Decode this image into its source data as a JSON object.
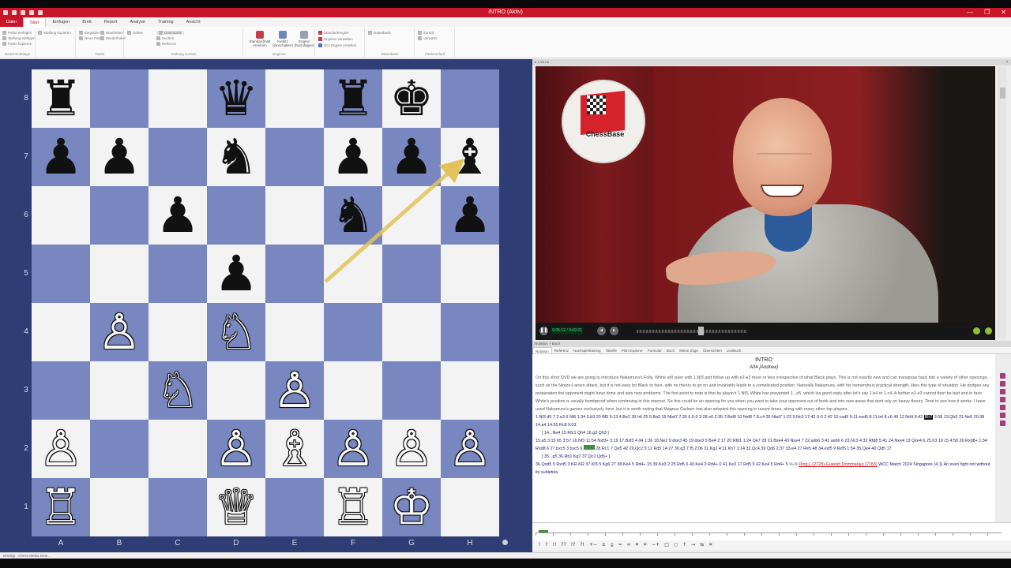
{
  "window": {
    "title": "INTRO (Aktiv)",
    "controls": [
      "—",
      "❐",
      "✕"
    ]
  },
  "ribbon_tabs": [
    "Datei",
    "Start",
    "Einfügen",
    "Brett",
    "Report",
    "Analyse",
    "Training",
    "Ansicht"
  ],
  "ribbon": {
    "groups": [
      {
        "label": "Zwischenablage",
        "items": [
          "Partie einfügen",
          "Stellung einfügen",
          "Partie kopieren",
          "Stellung kopieren"
        ]
      },
      {
        "label": "Partie",
        "items": [
          "Eingeben",
          "Neue Partie",
          "Bearbeiten",
          "Wiederholen"
        ]
      },
      {
        "label": "Stellung suchen",
        "items": [
          "Online",
          "Datenbank",
          "Suchen",
          "Referenz"
        ]
      },
      {
        "label": "",
        "items": [
          "Standardmatt",
          "Referenz"
        ]
      },
      {
        "label": "Engines",
        "items": [
          "Standardengine",
          "Kiebitz",
          "Engines verwalten",
          "UCI Engine erstellen"
        ]
      },
      {
        "label": "Datenbank",
        "items": [
          "Datenbank"
        ]
      },
      {
        "label": "Partieverlauf",
        "items": [
          "Zurück",
          "Vorwärts"
        ]
      }
    ],
    "big_buttons": [
      "Standardmatt ersetzen",
      "Kiebitz (einschalten)",
      "Engine (hinzufügen)"
    ]
  },
  "board": {
    "ranks": [
      "8",
      "7",
      "6",
      "5",
      "4",
      "3",
      "2",
      "1"
    ],
    "files": [
      "A",
      "B",
      "C",
      "D",
      "E",
      "F",
      "G",
      "H"
    ],
    "pieces": [
      {
        "sq": "a8",
        "glyph": "♜",
        "color": "black"
      },
      {
        "sq": "d8",
        "glyph": "♛",
        "color": "black"
      },
      {
        "sq": "f8",
        "glyph": "♜",
        "color": "black"
      },
      {
        "sq": "g8",
        "glyph": "♚",
        "color": "black"
      },
      {
        "sq": "a7",
        "glyph": "♟",
        "color": "black"
      },
      {
        "sq": "b7",
        "glyph": "♟",
        "color": "black"
      },
      {
        "sq": "d7",
        "glyph": "♞",
        "color": "black"
      },
      {
        "sq": "f7",
        "glyph": "♟",
        "color": "black"
      },
      {
        "sq": "g7",
        "glyph": "♟",
        "color": "black"
      },
      {
        "sq": "h7",
        "glyph": "♝",
        "color": "black"
      },
      {
        "sq": "c6",
        "glyph": "♟",
        "color": "black"
      },
      {
        "sq": "f6",
        "glyph": "♞",
        "color": "black"
      },
      {
        "sq": "h6",
        "glyph": "♟",
        "color": "black"
      },
      {
        "sq": "d5",
        "glyph": "♟",
        "color": "black"
      },
      {
        "sq": "b4",
        "glyph": "♙",
        "color": "white"
      },
      {
        "sq": "d4",
        "glyph": "♘",
        "color": "white"
      },
      {
        "sq": "c3",
        "glyph": "♘",
        "color": "white"
      },
      {
        "sq": "e3",
        "glyph": "♙",
        "color": "white"
      },
      {
        "sq": "a2",
        "glyph": "♙",
        "color": "white"
      },
      {
        "sq": "d2",
        "glyph": "♙",
        "color": "white"
      },
      {
        "sq": "e2",
        "glyph": "♗",
        "color": "white"
      },
      {
        "sq": "f2",
        "glyph": "♙",
        "color": "white"
      },
      {
        "sq": "g2",
        "glyph": "♙",
        "color": "white"
      },
      {
        "sq": "h2",
        "glyph": "♙",
        "color": "white"
      },
      {
        "sq": "a1",
        "glyph": "♖",
        "color": "white"
      },
      {
        "sq": "d1",
        "glyph": "♕",
        "color": "white"
      },
      {
        "sq": "f1",
        "glyph": "♖",
        "color": "white"
      },
      {
        "sq": "g1",
        "glyph": "♔",
        "color": "white"
      }
    ],
    "arrow": {
      "from": "f5",
      "to": "h7",
      "color": "#e3c25a"
    },
    "colors": {
      "light": "#f3f3f3",
      "dark": "#7887bf",
      "frame": "#2e3d73"
    }
  },
  "video": {
    "header": "▸ 1 v3 en",
    "logo_text": "ChessBase",
    "time": "0:05:12 / 0:09:21"
  },
  "notation_panel": {
    "header": "Notation + Buch",
    "tabs": [
      "Notation",
      "Referenz",
      "Nachspieltraining",
      "Tabelle",
      "Plan Explorer",
      "Formular",
      "Buch",
      "Meine Züge",
      "Übersichten",
      "LiveBuch"
    ],
    "active_tab": "Notation",
    "title": "INTRO",
    "eco": "A04",
    "annotator": "[Andrew]",
    "intro_text": "On this short DVD we are going to introduce Nakamura's Folly. White will open with 1.Nf3 and follow up with e2-e3 more or less irrespective of what Black plays. This is not exactly new and can transpose back into a variety of other openings, such as the Nimzo-Larsen attack, but it is not easy for Black to face, with no theory to go on and invariably leads to a complicated position. Naturally Nakamura, with his tremendous practical strength, likes this type of situation. He dodges any preparation the opponent might have done and sets new problems. The first point to note is that by playin's 1.Nf3, White has prevented 1...e5, which isa good reply after let's say 1.b4 or 1.c4. A further e2-e3 cannot then be bad and in face White's position is usually bombproof when continuing in this manner. So this could be an opening for you when you want to take your opponent out of book and into new areas that dont rely on heavy theory. Time to see how it works. I have used Nakamura's games exclusively here, but it is worth noting that Magnus Carlsen has also adopted this opening in recent times, along with many other top players.",
    "line1_moves": "1.Nf3 d5 7 2.e3 6 Nf6 1:34 3.b3 20 Bf5 5:13 4.Be2 39 h6 25 5.Ba3 15 Nbd7 7:26 6.0-0 3:28 e6 2:35 7.Bxf8 10 Nxf8 7 8.c4 35 Nbd7 1:23 9.Nc3 17:42 0-0 2:42 10.cxd5 5:11 exd5 8 11.b4 8 c6 49 12.Nd4 9:43",
    "line1_hl": "Bh7",
    "line1_tail": "3:58 13.Qb3 31 Ne5 20:38 14.a4 14:55 Rc8 9:03",
    "var1": "[ 14...Ne4 15.Rfc1 Qh4 16.g3 Qh3 ]",
    "line2": "15.a5 3:15 b5 3:57 16.Nf3 11:54 Nxf3+ 3:19 17.Bxf3 4 d4 1:36 18.Ne2 9 dxe3 45 19.dxe3 5 Be4 2:17 20.Rfd1 1:24 Qe7 28 21.Bxe4 43 Nxe4 7 22.axb6 3:41 axb6 6 23.Nc3 4:32 Rfd8 5:41 24.Nxe4 13 Qxe4 6 25.h3 19 c5 4:58 26.Rxd8+ 1:34 Rxd8 6 27.bxc5 3 bxc5 6",
    "line2_tail": "28.Rc1 7 Qe5 42 29.Qc2 5:12 Rd5 14:27 30.g3 7 f5 2:06 31.Kg2 4:11 Kh7 1:14 32.Qc4 39 Qd6 2:37 33.e4 27 Re5 48 34.exf5 9 Rxf5 1:54 35.Qe4 40 Qd5 17",
    "var2": "[ 35...g5 36.Rb1 Kg7 37.Qc2 Qd5+ ]",
    "line3": "36.Qxd5 5 Rxd5 3 KR-KR 37.Kf3 5 Kg6 27 38.Ke4 5 Rd4+ 15 39.Ke3 2:25 Rd5 6 40.Ke4 0 Rd4+ 0 41.Ke3 17 Rd5 9 42.Ke4 5 Rd4+ 5 ½-½",
    "players": "Ding,L (2728)-Gukesh Dommaraju (2783)",
    "event": "WCC Match 2024 Singapore (4.1) An even fight not without its subleties."
  },
  "toolbar_glyphs": [
    "!",
    "?",
    "!!",
    "??",
    "!?",
    "?!",
    "+−",
    "±",
    "⩲",
    "=",
    "∞",
    "⩱",
    "∓",
    "−+",
    "□",
    "○",
    "↑",
    "→",
    "⇆",
    "✕"
  ],
  "statusbar": "Erledigt · Chess Media Dete..."
}
